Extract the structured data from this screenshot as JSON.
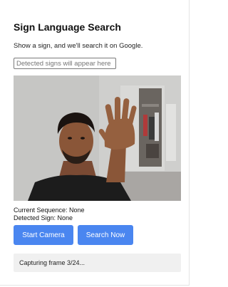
{
  "app": {
    "title": "Sign Language Search",
    "subtitle": "Show a sign, and we'll search it on Google."
  },
  "signs_input": {
    "value": "",
    "placeholder": "Detected signs will appear here"
  },
  "video": {
    "icon": "webcam-feed"
  },
  "info": {
    "current_sequence": "Current Sequence: None",
    "detected_sign": "Detected Sign: None"
  },
  "buttons": {
    "start_camera": "Start Camera",
    "search_now": "Search Now"
  },
  "status": {
    "message": "Capturing frame 3/24..."
  },
  "colors": {
    "accent": "#4a86f0",
    "status_bg": "#f0f0f0"
  }
}
